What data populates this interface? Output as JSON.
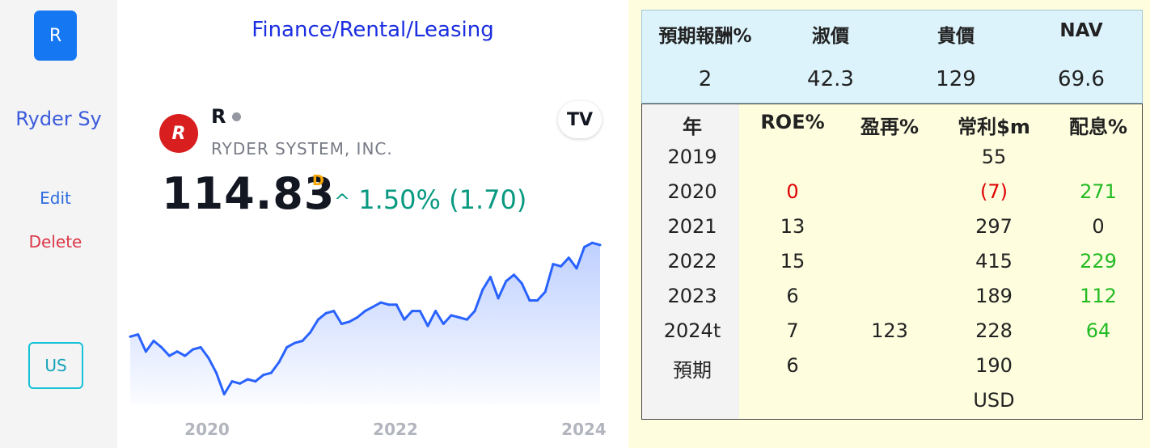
{
  "sidebar": {
    "r_button": "R",
    "company_short": "Ryder Sy",
    "edit_label": "Edit",
    "delete_label": "Delete",
    "market_button": "US"
  },
  "widget": {
    "industry": "Finance/Rental/Leasing",
    "logo_letter": "R",
    "ticker": "R",
    "company_full": "RYDER SYSTEM, INC.",
    "tv_logo": "TV",
    "price": "114.83",
    "price_flag": "D",
    "change_arrow": "^",
    "change": "1.50% (1.70)",
    "colors": {
      "up": "#089981",
      "line": "#2962ff",
      "flag": "#f7a600"
    }
  },
  "chart_data": {
    "type": "area",
    "x_tick_labels": [
      "2020",
      "2022",
      "2024"
    ],
    "x": [
      "2019-04",
      "2019-05",
      "2019-06",
      "2019-07",
      "2019-08",
      "2019-09",
      "2019-10",
      "2019-11",
      "2019-12",
      "2020-01",
      "2020-02",
      "2020-03",
      "2020-04",
      "2020-05",
      "2020-06",
      "2020-07",
      "2020-08",
      "2020-09",
      "2020-10",
      "2020-11",
      "2020-12",
      "2021-01",
      "2021-02",
      "2021-03",
      "2021-04",
      "2021-05",
      "2021-06",
      "2021-07",
      "2021-08",
      "2021-09",
      "2021-10",
      "2021-11",
      "2021-12",
      "2022-01",
      "2022-02",
      "2022-03",
      "2022-04",
      "2022-05",
      "2022-06",
      "2022-07",
      "2022-08",
      "2022-09",
      "2022-10",
      "2022-11",
      "2022-12",
      "2023-01",
      "2023-02",
      "2023-03",
      "2023-04",
      "2023-05",
      "2023-06",
      "2023-07",
      "2023-08",
      "2023-09",
      "2023-10",
      "2023-11",
      "2023-12",
      "2024-01",
      "2024-02",
      "2024-03",
      "2024-04"
    ],
    "values": [
      55,
      56,
      48,
      53,
      50,
      46,
      48,
      46,
      49,
      50,
      45,
      38,
      28,
      34,
      33,
      35,
      34,
      37,
      38,
      43,
      50,
      52,
      53,
      57,
      63,
      66,
      67,
      61,
      62,
      64,
      67,
      69,
      71,
      70,
      70,
      63,
      67,
      67,
      60,
      67,
      61,
      65,
      64,
      63,
      67,
      77,
      83,
      73,
      81,
      84,
      80,
      72,
      72,
      76,
      89,
      88,
      92,
      87,
      97,
      99,
      98
    ],
    "ylim": [
      24,
      101
    ]
  },
  "stats": {
    "headers": [
      "預期報酬%",
      "淑價",
      "貴價",
      "NAV"
    ],
    "values": [
      "2",
      "42.3",
      "129",
      "69.6"
    ]
  },
  "table": {
    "headers": [
      "年",
      "ROE%",
      "盈再%",
      "常利$m",
      "配息%"
    ],
    "rows": [
      [
        "2019",
        "",
        "",
        "55",
        ""
      ],
      [
        "2020",
        "0",
        "",
        "(7)",
        "271"
      ],
      [
        "2021",
        "13",
        "",
        "297",
        "0"
      ],
      [
        "2022",
        "15",
        "",
        "415",
        "229"
      ],
      [
        "2023",
        "6",
        "",
        "189",
        "112"
      ],
      [
        "2024t",
        "7",
        "123",
        "228",
        "64"
      ],
      [
        "預期",
        "6",
        "",
        "190",
        ""
      ],
      [
        "",
        "",
        "",
        "USD",
        ""
      ]
    ],
    "colors": {
      "negative": "#e00000",
      "positive": "#22bb22"
    }
  }
}
